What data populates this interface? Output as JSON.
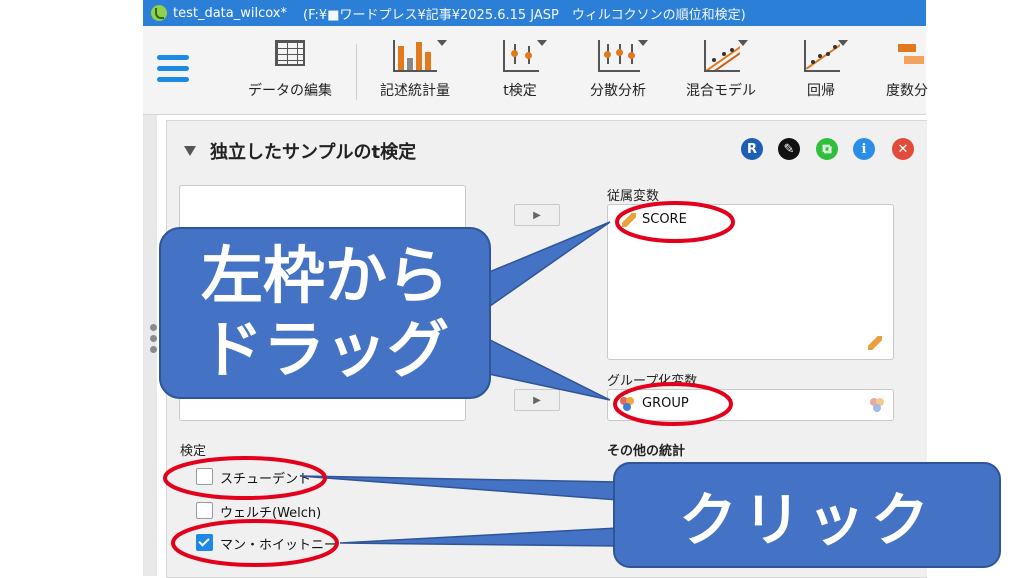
{
  "window": {
    "title": "test_data_wilcox*",
    "path": "(F:¥■ワードプレス¥記事¥2025.6.15 JASP　ウィルコクソンの順位和検定)"
  },
  "toolbar": {
    "items": [
      {
        "label": "データの編集",
        "icon": "table-grid-icon"
      },
      {
        "label": "記述統計量",
        "icon": "bar-chart-icon"
      },
      {
        "label": "t検定",
        "icon": "t-test-icon"
      },
      {
        "label": "分散分析",
        "icon": "anova-icon"
      },
      {
        "label": "混合モデル",
        "icon": "mixed-model-icon"
      },
      {
        "label": "回帰",
        "icon": "regression-icon"
      },
      {
        "label": "度数分",
        "icon": "frequency-icon"
      }
    ]
  },
  "analysis": {
    "title": "独立したサンプルのt検定",
    "buttons": [
      "R",
      "edit",
      "copy",
      "info",
      "close"
    ],
    "dependent": {
      "label": "従属変数",
      "variable": "SCORE"
    },
    "grouping": {
      "label": "グループ化変数",
      "variable": "GROUP"
    },
    "tests": {
      "label": "検定",
      "student": {
        "label": "スチューデント",
        "checked": false
      },
      "welch": {
        "label": "ウェルチ(Welch)",
        "checked": false
      },
      "mann_whitney": {
        "label": "マン・ホイットニー",
        "checked": true
      }
    },
    "other_stats": {
      "label": "その他の統計"
    }
  },
  "callouts": {
    "drag_line1": "左枠から",
    "drag_line2": "ドラッグ",
    "click": "クリック"
  },
  "colors": {
    "accent": "#1e88e5",
    "callout": "#4472c4",
    "highlight": "#e3001b"
  }
}
